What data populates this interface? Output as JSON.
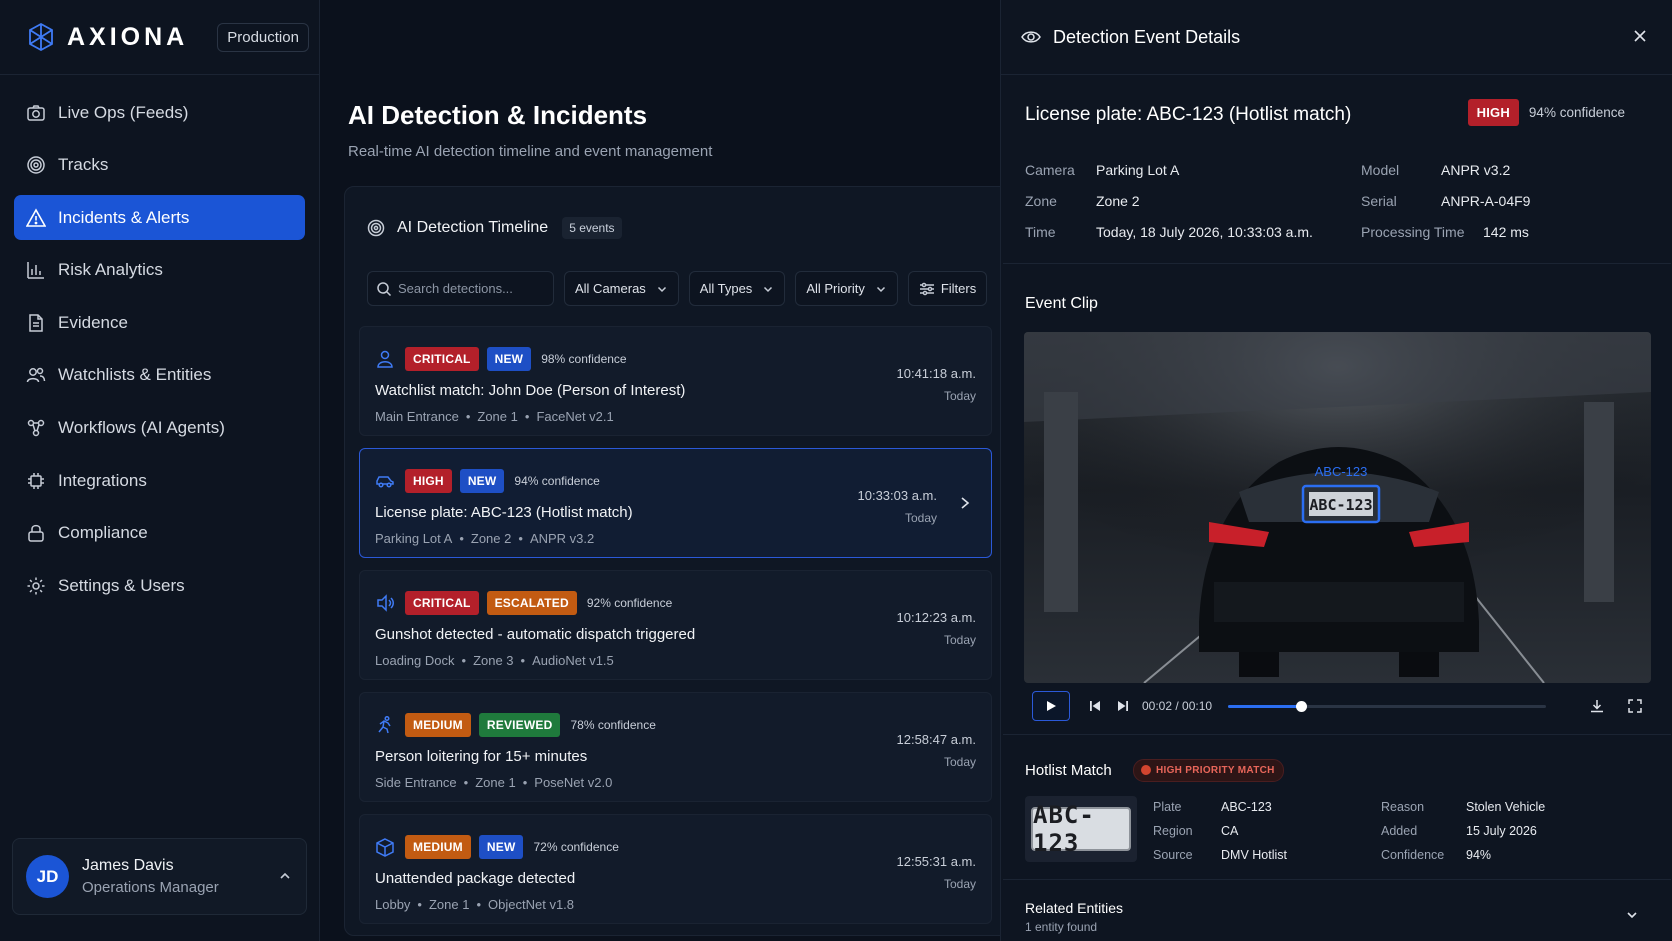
{
  "brand": {
    "name": "AXIONA",
    "env": "Production"
  },
  "nav": [
    {
      "label": "Live Ops (Feeds)",
      "icon": "camera-icon"
    },
    {
      "label": "Tracks",
      "icon": "target-icon"
    },
    {
      "label": "Incidents & Alerts",
      "icon": "alert-triangle-icon",
      "active": true
    },
    {
      "label": "Risk Analytics",
      "icon": "bar-chart-icon"
    },
    {
      "label": "Evidence",
      "icon": "file-icon"
    },
    {
      "label": "Watchlists & Entities",
      "icon": "users-icon"
    },
    {
      "label": "Workflows (AI Agents)",
      "icon": "workflow-icon"
    },
    {
      "label": "Integrations",
      "icon": "chip-icon"
    },
    {
      "label": "Compliance",
      "icon": "lock-icon"
    },
    {
      "label": "Settings & Users",
      "icon": "gear-icon"
    }
  ],
  "user": {
    "initials": "JD",
    "name": "James Davis",
    "role": "Operations Manager"
  },
  "page": {
    "title": "AI Detection & Incidents",
    "subtitle": "Real-time AI detection timeline and event management"
  },
  "timeline": {
    "title": "AI Detection Timeline",
    "count": "5 events",
    "search_placeholder": "Search detections...",
    "filters": [
      "All Cameras",
      "All Types",
      "All Priority"
    ],
    "filters_label": "Filters",
    "events": [
      {
        "icon": "person-icon",
        "badges": [
          {
            "text": "CRITICAL",
            "kind": "critical"
          },
          {
            "text": "NEW",
            "kind": "new"
          }
        ],
        "confidence": "98% confidence",
        "title": "Watchlist match: John Doe (Person of Interest)",
        "meta": [
          "Main Entrance",
          "Zone 1",
          "FaceNet v2.1"
        ],
        "time": "10:41:18 a.m.",
        "day": "Today"
      },
      {
        "icon": "car-icon",
        "badges": [
          {
            "text": "HIGH",
            "kind": "high"
          },
          {
            "text": "NEW",
            "kind": "new"
          }
        ],
        "confidence": "94% confidence",
        "title": "License plate: ABC-123 (Hotlist match)",
        "meta": [
          "Parking Lot A",
          "Zone 2",
          "ANPR v3.2"
        ],
        "time": "10:33:03 a.m.",
        "day": "Today",
        "selected": true
      },
      {
        "icon": "speaker-icon",
        "badges": [
          {
            "text": "CRITICAL",
            "kind": "critical"
          },
          {
            "text": "ESCALATED",
            "kind": "escalated"
          }
        ],
        "confidence": "92% confidence",
        "title": "Gunshot detected - automatic dispatch triggered",
        "meta": [
          "Loading Dock",
          "Zone 3",
          "AudioNet v1.5"
        ],
        "time": "10:12:23 a.m.",
        "day": "Today"
      },
      {
        "icon": "running-person-icon",
        "badges": [
          {
            "text": "MEDIUM",
            "kind": "medium"
          },
          {
            "text": "REVIEWED",
            "kind": "reviewed"
          }
        ],
        "confidence": "78% confidence",
        "title": "Person loitering for 15+ minutes",
        "meta": [
          "Side Entrance",
          "Zone 1",
          "PoseNet v2.0"
        ],
        "time": "12:58:47 a.m.",
        "day": "Today"
      },
      {
        "icon": "package-icon",
        "badges": [
          {
            "text": "MEDIUM",
            "kind": "medium"
          },
          {
            "text": "NEW",
            "kind": "new"
          }
        ],
        "confidence": "72% confidence",
        "title": "Unattended package detected",
        "meta": [
          "Lobby",
          "Zone 1",
          "ObjectNet v1.8"
        ],
        "time": "12:55:31 a.m.",
        "day": "Today"
      }
    ]
  },
  "details": {
    "panel_title": "Detection Event Details",
    "title": "License plate: ABC-123 (Hotlist match)",
    "priority": "HIGH",
    "confidence": "94% confidence",
    "fields_left": [
      {
        "k": "Camera",
        "v": "Parking Lot A"
      },
      {
        "k": "Zone",
        "v": "Zone 2"
      },
      {
        "k": "Time",
        "v": "Today, 18 July 2026, 10:33:03 a.m."
      }
    ],
    "fields_right": [
      {
        "k": "Model",
        "v": "ANPR v3.2"
      },
      {
        "k": "Serial",
        "v": "ANPR-A-04F9"
      },
      {
        "k": "Processing Time",
        "v": "142 ms"
      }
    ],
    "clip": {
      "title": "Event Clip",
      "overlay_label": "ABC-123",
      "plate_text": "ABC-123",
      "time": "00:02 / 00:10",
      "progress": 0.23
    },
    "hotlist": {
      "title": "Hotlist Match",
      "chip": "HIGH PRIORITY MATCH",
      "plate_image_text": "ABC-123",
      "fields_left": [
        {
          "k": "Plate",
          "v": "ABC-123"
        },
        {
          "k": "Region",
          "v": "CA"
        },
        {
          "k": "Source",
          "v": "DMV Hotlist"
        }
      ],
      "fields_right": [
        {
          "k": "Reason",
          "v": "Stolen Vehicle"
        },
        {
          "k": "Added",
          "v": "15 July 2026"
        },
        {
          "k": "Confidence",
          "v": "94%"
        }
      ]
    },
    "related": {
      "title": "Related Entities",
      "subtitle": "1 entity found"
    }
  },
  "colors": {
    "accent": "#1b55d6",
    "critical": "#b3202a",
    "medium": "#c25b12",
    "reviewed": "#1f7a3c",
    "new": "#1e4fc5"
  }
}
